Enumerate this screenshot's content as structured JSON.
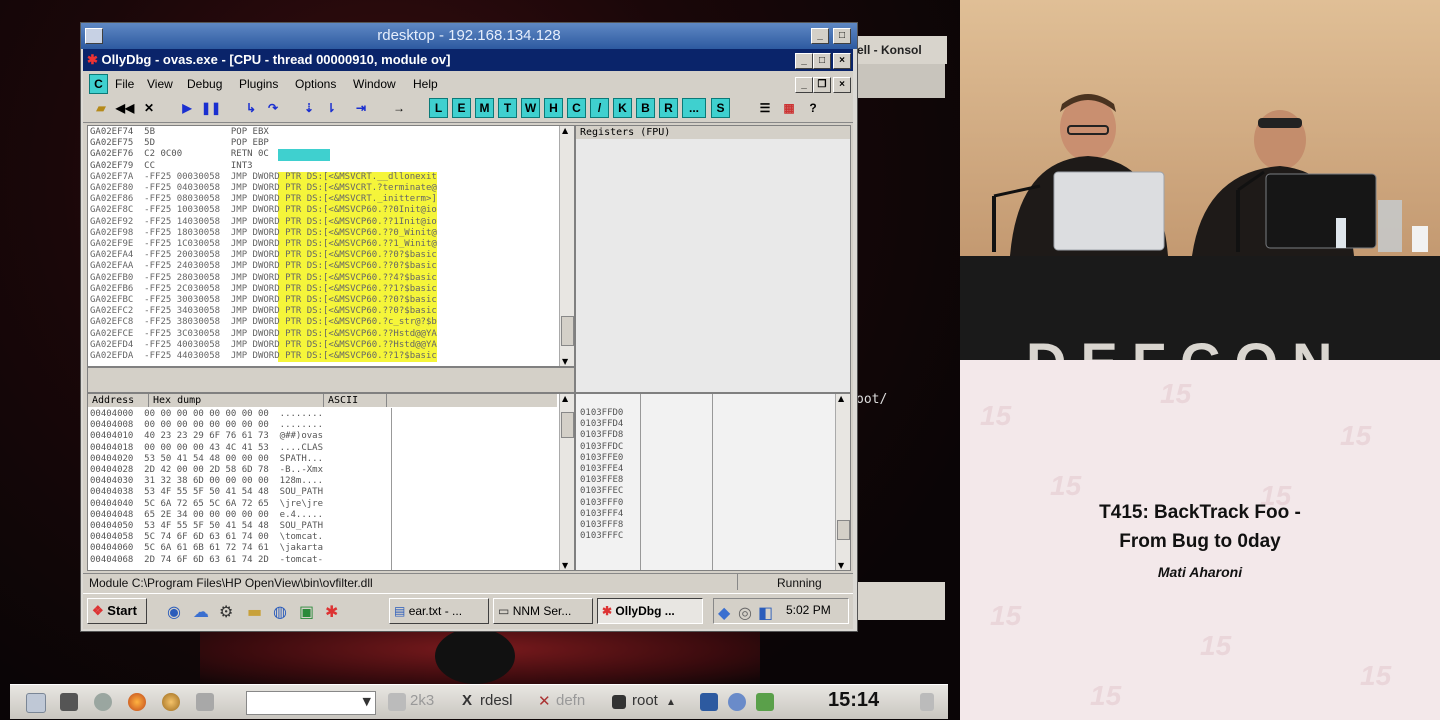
{
  "rdesktop": {
    "title": "rdesktop - 192.168.134.128"
  },
  "background": {
    "konsole_title": "ell - Konsol",
    "konsole_fragment": "oot/"
  },
  "olly": {
    "title": "OllyDbg - ovas.exe - [CPU - thread 00000910, module ov]",
    "menu": [
      "File",
      "View",
      "Debug",
      "Plugins",
      "Options",
      "Window",
      "Help"
    ],
    "toolbar_letters": [
      "L",
      "E",
      "M",
      "T",
      "W",
      "H",
      "C",
      "/",
      "K",
      "B",
      "R",
      "...",
      "S"
    ],
    "disasm_lines": [
      "GA02EF74  5B              POP EBX",
      "GA02EF75  5D              POP EBP",
      "GA02EF76  C2 0C00         RETN 0C",
      "GA02EF79  CC              INT3",
      "GA02EF7A  -FF25 00030058  JMP DWORD PTR DS:[<&MSVCRT.__dllonexit",
      "GA02EF80  -FF25 04030058  JMP DWORD PTR DS:[<&MSVCRT.?terminate@",
      "GA02EF86  -FF25 08030058  JMP DWORD PTR DS:[<&MSVCRT._initterm>]",
      "GA02EF8C  -FF25 10030058  JMP DWORD PTR DS:[<&MSVCP60.??0Init@io",
      "GA02EF92  -FF25 14030058  JMP DWORD PTR DS:[<&MSVCP60.??1Init@io",
      "GA02EF98  -FF25 18030058  JMP DWORD PTR DS:[<&MSVCP60.??0_Winit@",
      "GA02EF9E  -FF25 1C030058  JMP DWORD PTR DS:[<&MSVCP60.??1_Winit@",
      "GA02EFA4  -FF25 20030058  JMP DWORD PTR DS:[<&MSVCP60.??0?$basic",
      "GA02EFAA  -FF25 24030058  JMP DWORD PTR DS:[<&MSVCP60.??0?$basic",
      "GA02EFB0  -FF25 28030058  JMP DWORD PTR DS:[<&MSVCP60.??4?$basic",
      "GA02EFB6  -FF25 2C030058  JMP DWORD PTR DS:[<&MSVCP60.??1?$basic",
      "GA02EFBC  -FF25 30030058  JMP DWORD PTR DS:[<&MSVCP60.??0?$basic",
      "GA02EFC2  -FF25 34030058  JMP DWORD PTR DS:[<&MSVCP60.??0?$basic",
      "GA02EFC8  -FF25 38030058  JMP DWORD PTR DS:[<&MSVCP60.?c_str@?$b",
      "GA02EFCE  -FF25 3C030058  JMP DWORD PTR DS:[<&MSVCP60.??Hstd@@YA",
      "GA02EFD4  -FF25 40030058  JMP DWORD PTR DS:[<&MSVCP60.??Hstd@@YA",
      "GA02EFDA  -FF25 44030058  JMP DWORD PTR DS:[<&MSVCP60.??1?$basic"
    ],
    "registers_header": "Registers (FPU)",
    "dump_headers": [
      "Address",
      "Hex dump",
      "ASCII"
    ],
    "dump_lines": [
      "00404000  00 00 00 00 00 00 00 00  ........",
      "00404008  00 00 00 00 00 00 00 00  ........",
      "00404010  40 23 23 29 6F 76 61 73  @##)ovas",
      "00404018  00 00 00 00 43 4C 41 53  ....CLAS",
      "00404020  53 50 41 54 48 00 00 00  SPATH...",
      "00404028  2D 42 00 00 2D 58 6D 78  -B..-Xmx",
      "00404030  31 32 38 6D 00 00 00 00  128m....",
      "00404038  53 4F 55 5F 50 41 54 48  SOU_PATH",
      "00404040  5C 6A 72 65 5C 6A 72 65  \\jre\\jre",
      "00404048  65 2E 34 00 00 00 00 00  e.4.....",
      "00404050  53 4F 55 5F 50 41 54 48  SOU_PATH",
      "00404058  5C 74 6F 6D 63 61 74 00  \\tomcat.",
      "00404060  5C 6A 61 6B 61 72 74 61  \\jakarta",
      "00404068  2D 74 6F 6D 63 61 74 2D  -tomcat-"
    ],
    "stack_lines": [
      "0103FFD0",
      "0103FFD4",
      "0103FFD8",
      "0103FFDC",
      "0103FFE0",
      "0103FFE4",
      "0103FFE8",
      "0103FFEC",
      "0103FFF0",
      "0103FFF4",
      "0103FFF8",
      "0103FFFC"
    ],
    "status_module": "Module C:\\Program Files\\HP OpenView\\bin\\ovfilter.dll",
    "status_state": "Running"
  },
  "win_taskbar": {
    "start": "Start",
    "tasks": [
      "ear.txt - ...",
      "NNM Ser...",
      "OllyDbg ..."
    ],
    "clock": "5:02 PM"
  },
  "kde_taskbar": {
    "tasks": [
      "2k3",
      "rdesl",
      "defn",
      "root"
    ],
    "clock": "15:14"
  },
  "stage": {
    "banner": "DEFCON"
  },
  "slide": {
    "title_line1": "T415: BackTrack Foo -",
    "title_line2": "From Bug to 0day",
    "speaker": "Mati Aharoni"
  }
}
